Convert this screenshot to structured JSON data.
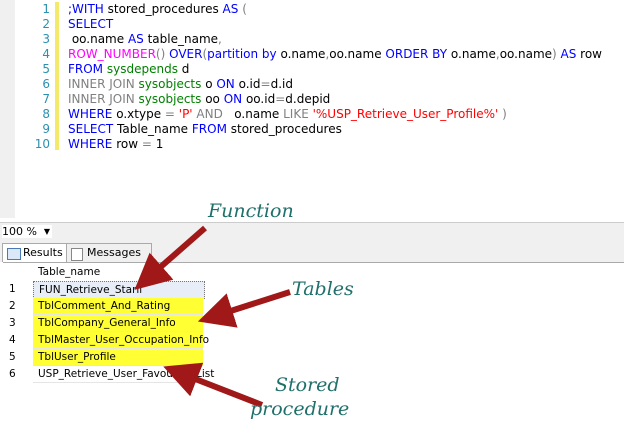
{
  "editor": {
    "lines": [
      {
        "n": "1",
        "parts": [
          [
            "k",
            ";WITH "
          ],
          [
            "",
            ""
          ],
          [
            "",
            "stored_procedures "
          ],
          [
            "k",
            "AS "
          ],
          [
            "g",
            "("
          ]
        ]
      },
      {
        "n": "2",
        "parts": [
          [
            "k",
            "SELECT"
          ]
        ]
      },
      {
        "n": "3",
        "parts": [
          [
            "",
            " oo.name "
          ],
          [
            "k",
            "AS "
          ],
          [
            "",
            "table_name"
          ],
          [
            "g",
            ","
          ]
        ]
      },
      {
        "n": "4",
        "parts": [
          [
            "f",
            "ROW_NUMBER"
          ],
          [
            "g",
            "() "
          ],
          [
            "k",
            "OVER"
          ],
          [
            "g",
            "("
          ],
          [
            "k",
            "partition by "
          ],
          [
            "",
            "o.name"
          ],
          [
            "g",
            ","
          ],
          [
            "",
            "oo.name "
          ],
          [
            "k",
            "ORDER BY "
          ],
          [
            "",
            "o.name"
          ],
          [
            "g",
            ","
          ],
          [
            "",
            "oo.name"
          ],
          [
            "g",
            ") "
          ],
          [
            "k",
            "AS "
          ],
          [
            "",
            "row"
          ]
        ]
      },
      {
        "n": "5",
        "parts": [
          [
            "k",
            "FROM "
          ],
          [
            "t",
            "sysdepends "
          ],
          [
            "",
            "d"
          ]
        ]
      },
      {
        "n": "6",
        "parts": [
          [
            "g",
            "INNER JOIN "
          ],
          [
            "t",
            "sysobjects "
          ],
          [
            "",
            "o "
          ],
          [
            "k",
            "ON "
          ],
          [
            "",
            "o.id"
          ],
          [
            "g",
            "="
          ],
          [
            "",
            "d.id"
          ]
        ]
      },
      {
        "n": "7",
        "parts": [
          [
            "g",
            "INNER JOIN "
          ],
          [
            "t",
            "sysobjects "
          ],
          [
            "",
            "oo "
          ],
          [
            "k",
            "ON "
          ],
          [
            "",
            "oo.id"
          ],
          [
            "g",
            "="
          ],
          [
            "",
            "d.depid"
          ]
        ]
      },
      {
        "n": "8",
        "parts": [
          [
            "k",
            "WHERE "
          ],
          [
            "",
            "o.xtype "
          ],
          [
            "g",
            "= "
          ],
          [
            "s",
            "'P' "
          ],
          [
            "g",
            "AND   "
          ],
          [
            "",
            "o.name "
          ],
          [
            "g",
            "LIKE "
          ],
          [
            "s",
            "'%USP_Retrieve_User_Profile%' "
          ],
          [
            "g",
            ")"
          ]
        ]
      },
      {
        "n": "9",
        "parts": [
          [
            "k",
            "SELECT "
          ],
          [
            "",
            "Table_name "
          ],
          [
            "k",
            "FROM "
          ],
          [
            "",
            "stored_procedures"
          ]
        ]
      },
      {
        "n": "10",
        "parts": [
          [
            "k",
            "WHERE "
          ],
          [
            "",
            "row "
          ],
          [
            "g",
            "= "
          ],
          [
            "",
            "1"
          ]
        ]
      }
    ]
  },
  "zoom": "100 %",
  "tabs": {
    "results": "Results",
    "messages": "Messages"
  },
  "grid": {
    "header": "Table_name",
    "rows": [
      {
        "n": "1",
        "v": "FUN_Retrieve_Starli",
        "hl": false
      },
      {
        "n": "2",
        "v": "TblComment_And_Rating",
        "hl": true
      },
      {
        "n": "3",
        "v": "TblCompany_General_Info",
        "hl": true
      },
      {
        "n": "4",
        "v": "TblMaster_User_Occupation_Info",
        "hl": true
      },
      {
        "n": "5",
        "v": "TblUser_Profile",
        "hl": true
      },
      {
        "n": "6",
        "v": "USP_Retrieve_User_Favourite_List",
        "hl": false
      }
    ]
  },
  "annotations": {
    "function": "Function",
    "tables": "Tables",
    "stored1": "Stored",
    "stored2": "procedure"
  },
  "colors": {
    "highlight": "#ffff33",
    "arrow": "#a01818"
  }
}
